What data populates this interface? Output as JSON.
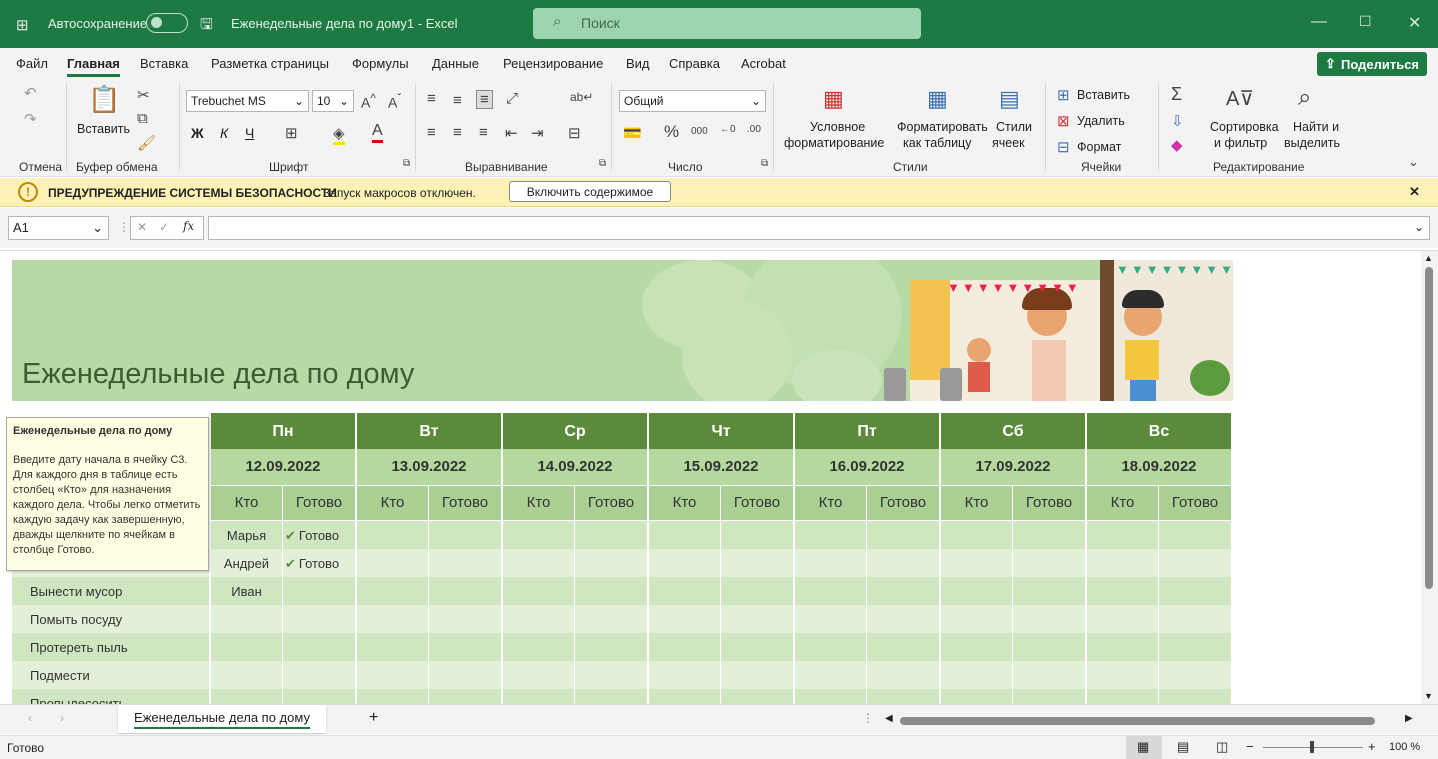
{
  "titlebar": {
    "autosave": "Автосохранение",
    "filename": "Еженедельные дела по дому1  -  Excel",
    "search_placeholder": "Поиск"
  },
  "menu": {
    "items": [
      "Файл",
      "Главная",
      "Вставка",
      "Разметка страницы",
      "Формулы",
      "Данные",
      "Рецензирование",
      "Вид",
      "Справка",
      "Acrobat"
    ],
    "share": "Поделиться"
  },
  "ribbon": {
    "undo_group": "Отмена",
    "clipboard": {
      "paste": "Вставить",
      "group": "Буфер обмена"
    },
    "font": {
      "name": "Trebuchet MS",
      "size": "10",
      "bold": "Ж",
      "italic": "К",
      "underline": "Ч",
      "group": "Шрифт"
    },
    "alignment": {
      "group": "Выравнивание"
    },
    "number": {
      "format": "Общий",
      "group": "Число"
    },
    "styles": {
      "cond1": "Условное",
      "cond2": "форматирование",
      "fmt1": "Форматировать",
      "fmt2": "как таблицу",
      "cell1": "Стили",
      "cell2": "ячеек",
      "group": "Стили"
    },
    "cells": {
      "insert": "Вставить",
      "delete": "Удалить",
      "format": "Формат",
      "group": "Ячейки"
    },
    "editing": {
      "sort1": "Сортировка",
      "sort2": "и фильтр",
      "find1": "Найти и",
      "find2": "выделить",
      "group": "Редактирование"
    }
  },
  "security": {
    "title": "ПРЕДУПРЕЖДЕНИЕ СИСТЕМЫ БЕЗОПАСНОСТИ",
    "message": "Запуск макросов отключен.",
    "button": "Включить содержимое"
  },
  "formula_bar": {
    "cell_ref": "A1",
    "fx": "fx",
    "value": ""
  },
  "sheet": {
    "title": "Еженедельные дела по дому",
    "tooltip_title": "Еженедельные дела по дому",
    "tooltip_text": "Введите дату начала в ячейку C3. Для каждого дня в таблице есть столбец «Кто» для назначения каждого дела. Чтобы легко отметить каждую задачу как завершенную, дважды щелкните по ячейкам в столбце Готово.",
    "days": [
      {
        "day": "Пн",
        "date": "12.09.2022"
      },
      {
        "day": "Вт",
        "date": "13.09.2022"
      },
      {
        "day": "Ср",
        "date": "14.09.2022"
      },
      {
        "day": "Чт",
        "date": "15.09.2022"
      },
      {
        "day": "Пт",
        "date": "16.09.2022"
      },
      {
        "day": "Сб",
        "date": "17.09.2022"
      },
      {
        "day": "Вс",
        "date": "18.09.2022"
      }
    ],
    "who_label": "Кто",
    "done_label": "Готово",
    "rows": [
      {
        "task": "",
        "who": "Марья",
        "done": "Готово"
      },
      {
        "task": "",
        "who": "Андрей",
        "done": "Готово"
      },
      {
        "task": "Вынести мусор",
        "who": "Иван",
        "done": ""
      },
      {
        "task": "Помыть посуду",
        "who": "",
        "done": ""
      },
      {
        "task": "Протереть пыль",
        "who": "",
        "done": ""
      },
      {
        "task": "Подмести",
        "who": "",
        "done": ""
      },
      {
        "task": "Пропылесосить",
        "who": "",
        "done": ""
      }
    ]
  },
  "tabs": {
    "active": "Еженедельные дела по дому"
  },
  "status": {
    "ready": "Готово",
    "zoom": "100 %"
  },
  "colors": {
    "excel_green": "#1d7a42",
    "header_green": "#5a8a3a",
    "banner_green": "#b7d9a5"
  }
}
